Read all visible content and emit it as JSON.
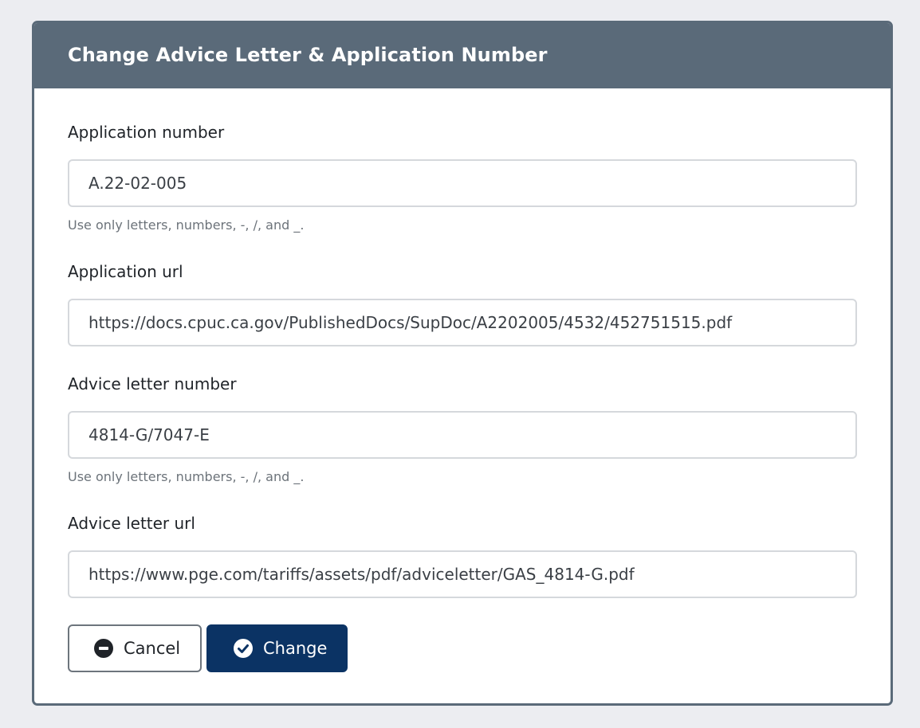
{
  "dialog": {
    "title": "Change Advice Letter & Application Number"
  },
  "fields": {
    "application_number": {
      "label": "Application number",
      "value": "A.22-02-005",
      "help": "Use only letters, numbers, -, /, and _."
    },
    "application_url": {
      "label": "Application url",
      "value": "https://docs.cpuc.ca.gov/PublishedDocs/SupDoc/A2202005/4532/452751515.pdf"
    },
    "advice_letter_number": {
      "label": "Advice letter number",
      "value": "4814-G/7047-E",
      "help": "Use only letters, numbers, -, /, and _."
    },
    "advice_letter_url": {
      "label": "Advice letter url",
      "value": "https://www.pge.com/tariffs/assets/pdf/adviceletter/GAS_4814-G.pdf"
    }
  },
  "buttons": {
    "cancel": {
      "label": "Cancel",
      "icon": "minus-circle-icon"
    },
    "change": {
      "label": "Change",
      "icon": "check-circle-icon"
    }
  },
  "colors": {
    "header_bg": "#5a6a79",
    "primary_button": "#0b3364",
    "page_bg": "#ecedf1"
  }
}
